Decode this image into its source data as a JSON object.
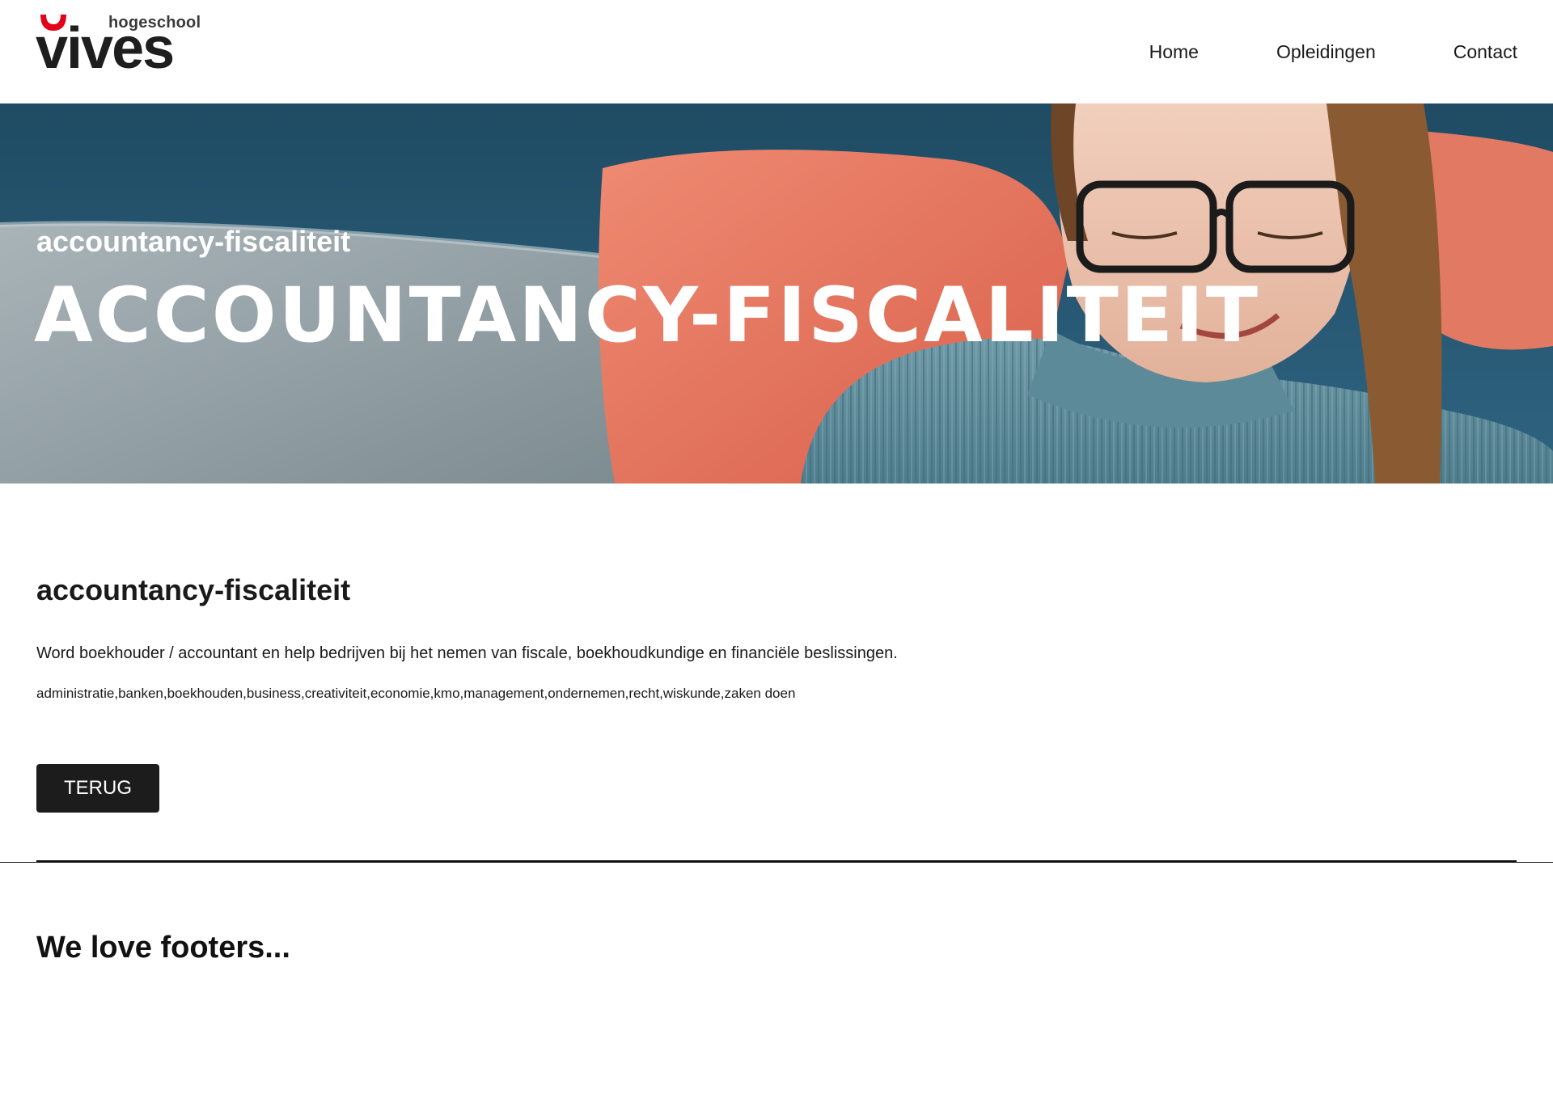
{
  "brand": {
    "logo_sub": "hogeschool",
    "logo_main": "vives",
    "accent_color": "#e2001a"
  },
  "nav": {
    "items": [
      {
        "label": "Home"
      },
      {
        "label": "Opleidingen"
      },
      {
        "label": "Contact"
      }
    ]
  },
  "hero": {
    "subtitle": "accountancy-fiscaliteit",
    "title": "ACCOUNTANCY-FISCALITEIT"
  },
  "content": {
    "title": "accountancy-fiscaliteit",
    "description": "Word boekhouder / accountant en help bedrijven bij het nemen van fiscale, boekhoudkundige en financiële beslissingen.",
    "tags": "administratie,banken,boekhouden,business,creativiteit,economie,kmo,management,ondernemen,recht,wiskunde,zaken doen",
    "back_label": "TERUG"
  },
  "footer": {
    "title": "We love footers..."
  }
}
